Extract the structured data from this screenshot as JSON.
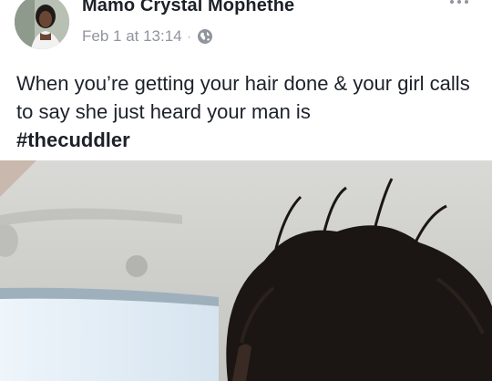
{
  "post": {
    "author": "Mamo Crystal Mophethe",
    "date": "Feb 1 at 13:14",
    "separator": "·",
    "text": "When you’re getting your hair done & your girl calls to say she just heard your man is",
    "hashtag": "#thecuddler"
  },
  "icons": {
    "privacy": "globe-icon",
    "menu": "more-options-icon"
  },
  "colors": {
    "author_text": "#1d2129",
    "meta_text": "#90949c"
  }
}
